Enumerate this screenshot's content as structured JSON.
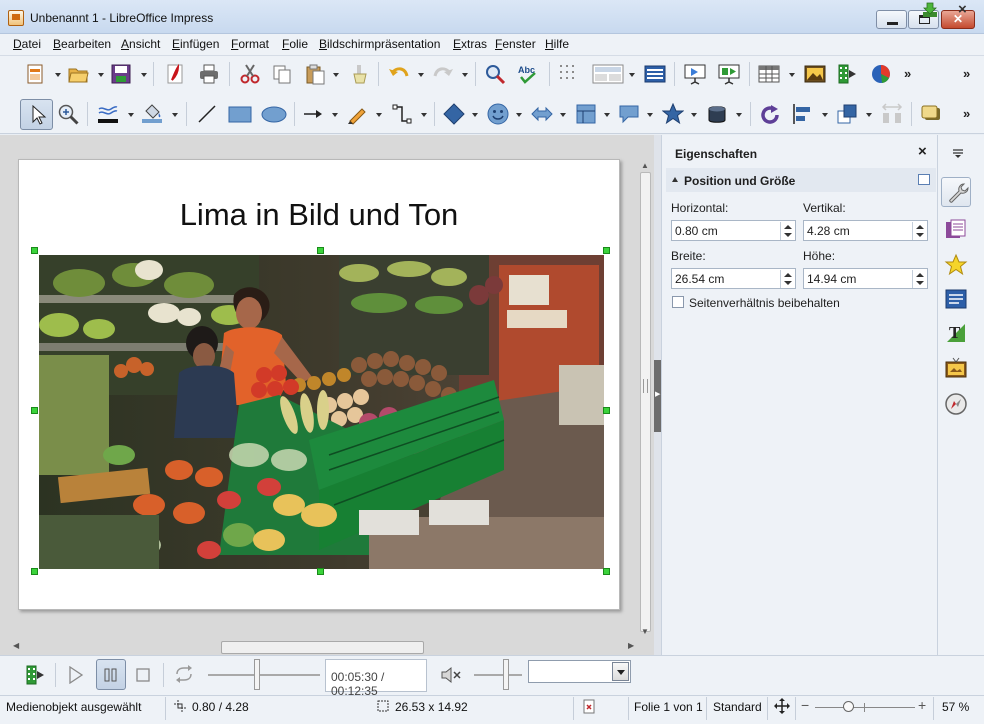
{
  "window": {
    "title": "Unbenannt 1 - LibreOffice Impress"
  },
  "menu": {
    "items": [
      {
        "label": "Datei",
        "u": "D",
        "rest": "atei"
      },
      {
        "label": "Bearbeiten",
        "u": "B",
        "rest": "earbeiten"
      },
      {
        "label": "Ansicht",
        "u": "A",
        "rest": "nsicht"
      },
      {
        "label": "Einfügen",
        "u": "E",
        "rest": "infügen"
      },
      {
        "label": "Format",
        "u": "F",
        "rest": "ormat"
      },
      {
        "label": "Folie",
        "u": "F",
        "rest": "olie"
      },
      {
        "label": "Bildschirmpräsentation",
        "u": "B",
        "rest": "ildschirmpräsentation"
      },
      {
        "label": "Extras",
        "u": "E",
        "rest": "xtras"
      },
      {
        "label": "Fenster",
        "u": "F",
        "rest": "enster"
      },
      {
        "label": "Hilfe",
        "u": "H",
        "rest": "ilfe"
      }
    ],
    "close_glyph": "×"
  },
  "toolbar": {
    "overflow_glyph": "»"
  },
  "slide": {
    "title": "Lima in Bild und Ton"
  },
  "sidebar": {
    "title": "Eigenschaften",
    "close_glyph": "×",
    "section_title": "Position und Größe",
    "horizontal_label": "Horizontal:",
    "horizontal_value": "0.80 cm",
    "vertical_label": "Vertikal:",
    "vertical_value": "4.28 cm",
    "width_label": "Breite:",
    "width_value": "26.54 cm",
    "height_label": "Höhe:",
    "height_value": "14.94 cm",
    "keep_ratio_label": "Seitenverhältnis beibehalten",
    "keep_ratio_checked": false
  },
  "media": {
    "time": "00:05:30 / 00:12:35",
    "zoom_value": ""
  },
  "status": {
    "selection": "Medienobjekt ausgewählt",
    "position": "0.80 / 4.28",
    "size": "26.53 x 14.92",
    "slide": "Folie 1 von 1",
    "layout": "Standard",
    "zoom_percent": "57 %",
    "zoom_level": 0.57,
    "zoom_minus": "−",
    "zoom_plus": "+"
  }
}
